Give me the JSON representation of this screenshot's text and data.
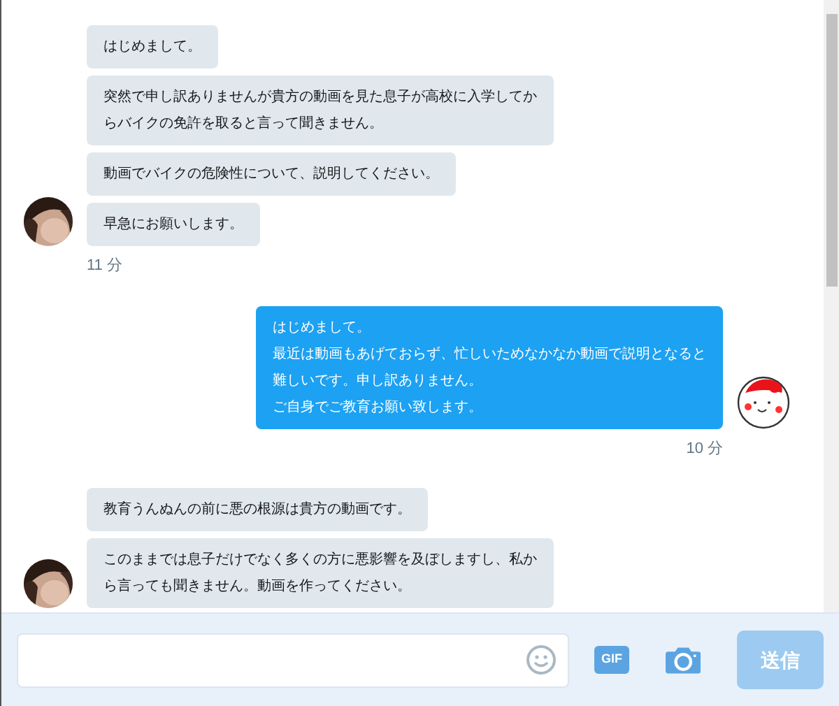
{
  "conversation": [
    {
      "kind": "received",
      "bubbles": [
        "はじめまして。",
        "突然で申し訳ありませんが貴方の動画を見た息子が高校に入学してからバイクの免許を取ると言って聞きません。",
        "動画でバイクの危険性について、説明してください。",
        "早急にお願いします。"
      ],
      "time": "11 分"
    },
    {
      "kind": "sent",
      "bubbles": [
        [
          "はじめまして。",
          "最近は動画もあげておらず、忙しいためなかなか動画で説明となると難しいです。申し訳ありません。",
          "ご自身でご教育お願い致します。"
        ]
      ],
      "time": "10 分"
    },
    {
      "kind": "received",
      "bubbles": [
        "教育うんぬんの前に悪の根源は貴方の動画です。",
        "このままでは息子だけでなく多くの方に悪影響を及ぼしますし、私から言っても聞きません。動画を作ってください。"
      ]
    }
  ],
  "composer": {
    "gif_label": "GIF",
    "send_button": {
      "label": "送信",
      "disabled": true
    }
  }
}
